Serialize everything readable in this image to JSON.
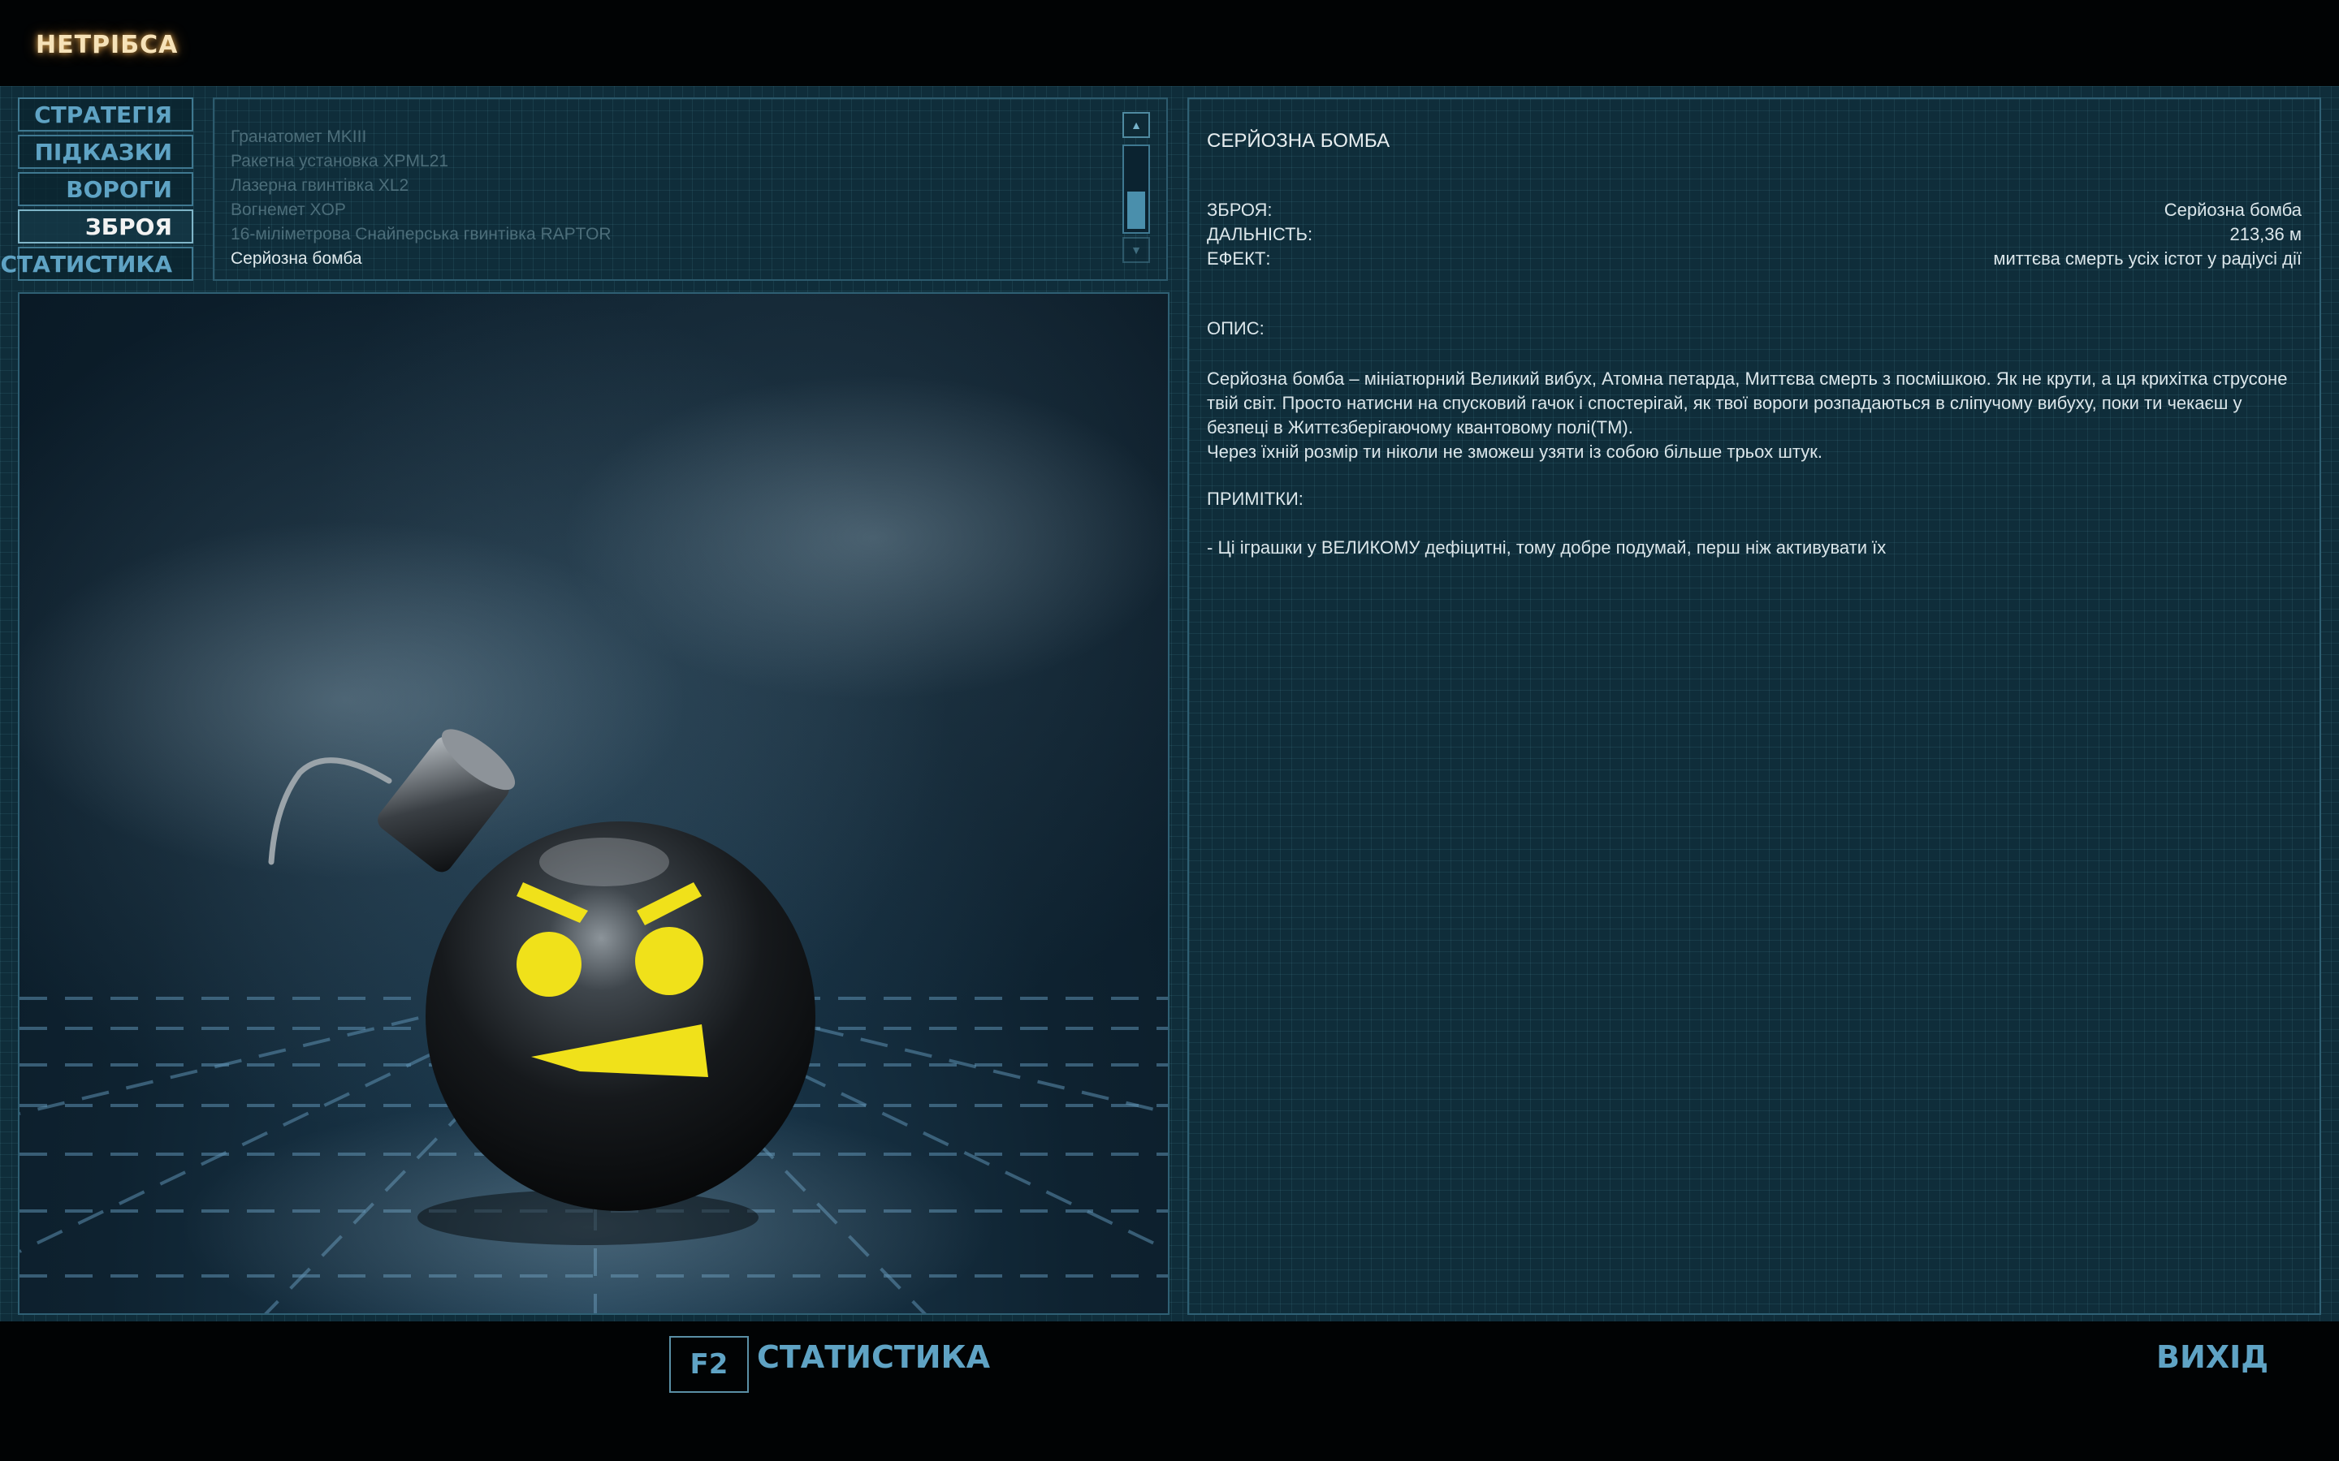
{
  "header": {
    "title": "НЕТРІБСА"
  },
  "nav": {
    "items": [
      {
        "label": "СТРАТЕГІЯ",
        "active": false
      },
      {
        "label": "ПІДКАЗКИ",
        "active": false
      },
      {
        "label": "ВОРОГИ",
        "active": false
      },
      {
        "label": "ЗБРОЯ",
        "active": true
      },
      {
        "label": "СТАТИСТИКА",
        "active": false
      }
    ]
  },
  "weapon_list": {
    "items": [
      "Гранатомет MKIII",
      "Ракетна установка XPML21",
      "Лазерна гвинтівка XL2",
      "Вогнемет XOP",
      "16-міліметрова Снайперська гвинтівка RAPTOR",
      "Серйозна бомба"
    ],
    "selected_index": 5,
    "scroll_position": 0.9
  },
  "details": {
    "title": "СЕРЙОЗНА БОМБА",
    "stats": [
      {
        "label": "ЗБРОЯ:",
        "value": "Серйозна бомба"
      },
      {
        "label": "ДАЛЬНІСТЬ:",
        "value": "213,36 м"
      },
      {
        "label": "ЕФЕКТ:",
        "value": "миттєва смерть усіх істот у радіусі дії"
      }
    ],
    "description_label": "ОПИС:",
    "description": [
      "Серйозна бомба – мініатюрний Великий вибух, Атомна петарда, Миттєва смерть з посмішкою. Як не крути, а ця крихітка струсоне твій світ. Просто натисни на спусковий гачок і спостерігай, як твої вороги розпадаються в сліпучому вибуху, поки ти чекаєш у безпеці в Життєзберігаючому квантовому полі(TM).",
      "Через їхній розмір ти ніколи не зможеш узяти із собою більше трьох штук."
    ],
    "notes_label": "ПРИМІТКИ:",
    "notes": "- Ці іграшки у ВЕЛИКОМУ дефіцитні, тому добре подумай, перш ніж активувати їх"
  },
  "footer": {
    "hotkey": "F2",
    "stats_label": "СТАТИСТИКА",
    "exit_label": "ВИХІД"
  },
  "colors": {
    "accent": "#5fa3c4",
    "bomb_face": "#f0e11a",
    "title_glow": "#f6e2b8"
  }
}
